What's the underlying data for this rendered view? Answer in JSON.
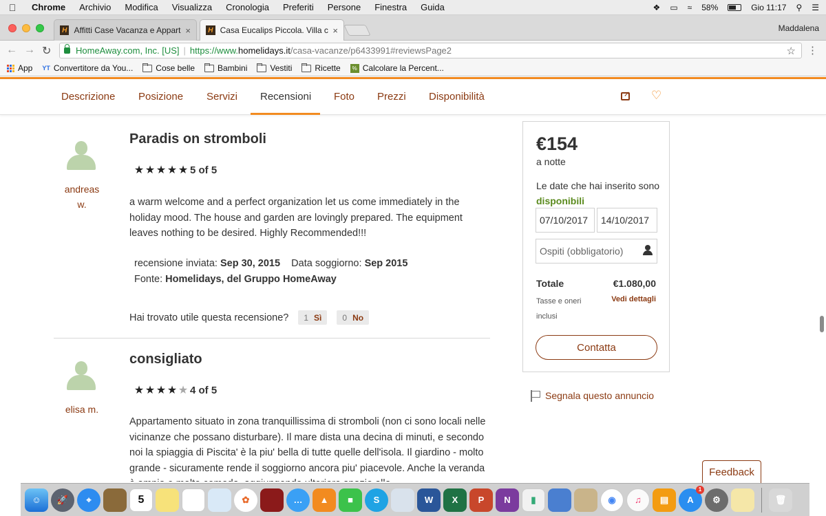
{
  "menubar": {
    "app": "Chrome",
    "items": [
      "Archivio",
      "Modifica",
      "Visualizza",
      "Cronologia",
      "Preferiti",
      "Persone",
      "Finestra",
      "Guida"
    ],
    "battery": "58%",
    "clock": "Gio 11:17"
  },
  "tabs": [
    {
      "title": "Affitti Case Vacanza e Appartam",
      "favicon": "H"
    },
    {
      "title": "Casa Eucalips Piccola. Villa con",
      "favicon": "H"
    }
  ],
  "profile": "Maddalena",
  "address": {
    "secure_label": "HomeAway.com, Inc. [US]",
    "scheme": "https://www.",
    "host": "homelidays.it",
    "path": "/casa-vacanze/p6433991#reviewsPage2"
  },
  "bookmarks": [
    {
      "label": "App",
      "icon": "apps-grid-icon"
    },
    {
      "label": "Convertitore da You...",
      "icon": "yt-converter-icon"
    },
    {
      "label": "Cose belle",
      "icon": "folder-icon"
    },
    {
      "label": "Bambini",
      "icon": "folder-icon"
    },
    {
      "label": "Vestiti",
      "icon": "folder-icon"
    },
    {
      "label": "Ricette",
      "icon": "folder-icon"
    },
    {
      "label": "Calcolare la Percent...",
      "icon": "calculator-icon"
    }
  ],
  "sitenav": {
    "items": [
      "Descrizione",
      "Posizione",
      "Servizi",
      "Recensioni",
      "Foto",
      "Prezzi",
      "Disponibilità"
    ],
    "active": "Recensioni"
  },
  "reviews": [
    {
      "reviewer_line1": "andreas",
      "reviewer_line2": "w.",
      "title": "Paradis on stromboli",
      "rating": 5,
      "rating_label": "5 of 5",
      "body": "a warm welcome and a perfect organization let us come immediately in the holiday mood. The house and garden are lovingly prepared. The equipment leaves nothing to be desired. Highly Recommended!!!",
      "sent_label": "recensione inviata:",
      "sent_date": "Sep 30, 2015",
      "stay_label": "Data soggiorno:",
      "stay_date": "Sep 2015",
      "source_label": "Fonte:",
      "source": "Homelidays, del Gruppo HomeAway",
      "helpful_question": "Hai trovato utile questa recensione?",
      "yes_count": "1",
      "yes_label": "Sì",
      "no_count": "0",
      "no_label": "No"
    },
    {
      "reviewer_line1": "elisa m.",
      "title": "consigliato",
      "rating": 4,
      "rating_label": "4 of 5",
      "body": "Appartamento situato in zona tranquillissima di stromboli (non ci sono locali nelle vicinanze che possano disturbare). Il mare dista una decina di minuti, e secondo noi la spiaggia di Piscita' è la piu' bella di tutte quelle dell'isola. Il giardino - molto grande - sicuramente rende il soggiorno ancora piu' piacevole. Anche la veranda è ampia e molto comoda, aggiungendo ulteriore spazio alla"
    }
  ],
  "booking": {
    "price": "€154",
    "per_night": "a notte",
    "avail_text": "Le date che hai inserito sono",
    "avail_status": "disponibili",
    "checkin": "07/10/2017",
    "checkout": "14/10/2017",
    "guests_placeholder": "Ospiti (obbligatorio)",
    "total_label": "Totale",
    "total_value": "€1.080,00",
    "taxes_note": "Tasse e oneri inclusi",
    "details_link": "Vedi dettagli",
    "contact_label": "Contatta"
  },
  "report_link": "Segnala questo annuncio",
  "feedback_label": "Feedback",
  "calendar_day": "5",
  "appstore_badge": "1",
  "colors": {
    "accent_orange": "#f28b20",
    "link_brown": "#8b3a12",
    "available_green": "#5a8a1d"
  }
}
